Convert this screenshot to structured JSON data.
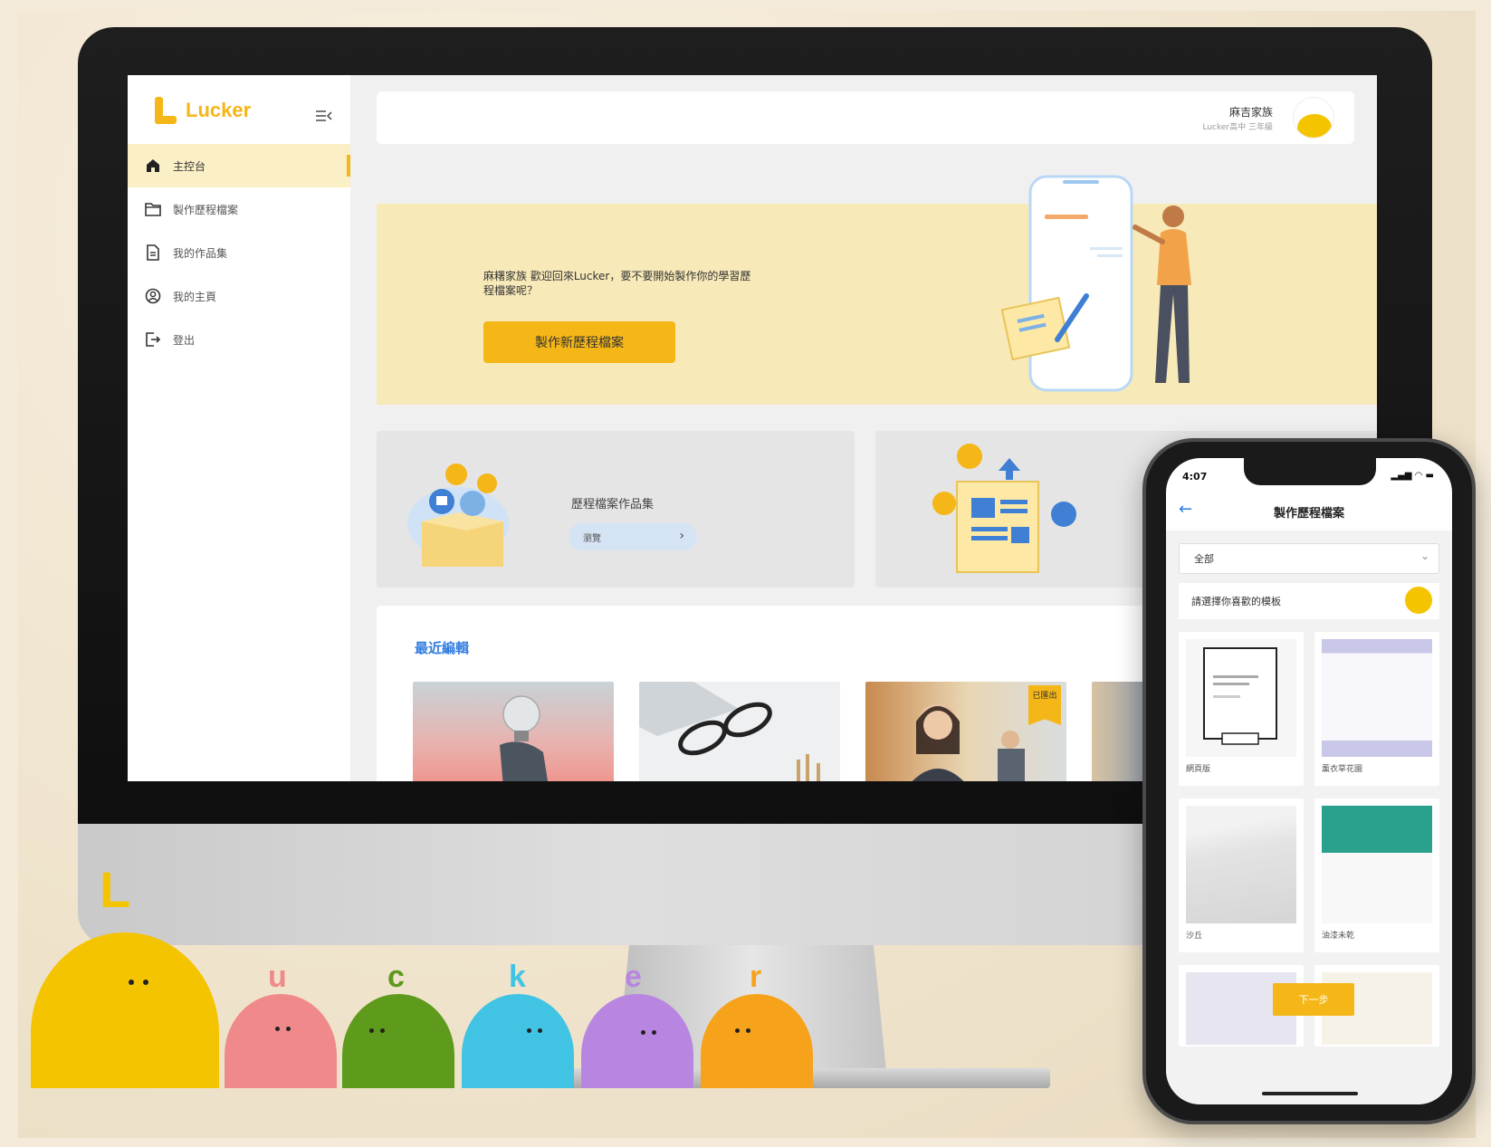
{
  "app": {
    "brand": "Lucker",
    "colors": {
      "accent": "#f5b617",
      "link": "#2f7be0",
      "hero_bg": "#f8e9b8"
    }
  },
  "sidebar": {
    "items": [
      {
        "label": "主控台",
        "icon": "home-icon",
        "active": true
      },
      {
        "label": "製作歷程檔案",
        "icon": "folder-icon",
        "active": false
      },
      {
        "label": "我的作品集",
        "icon": "document-icon",
        "active": false
      },
      {
        "label": "我的主頁",
        "icon": "user-circle-icon",
        "active": false
      },
      {
        "label": "登出",
        "icon": "logout-icon",
        "active": false
      }
    ]
  },
  "user": {
    "name": "麻吉家族",
    "meta": "Lucker高中 三年級"
  },
  "hero": {
    "message": "麻糬家族 歡迎回來Lucker，要不要開始製作你的學習歷程檔案呢？",
    "button": "製作新歷程檔案"
  },
  "cards": [
    {
      "title": "歷程檔案作品集",
      "button": "瀏覽"
    }
  ],
  "recent": {
    "title": "最近編輯",
    "items": [
      {
        "image": "lightbulb-photo"
      },
      {
        "image": "glasses-photo"
      },
      {
        "image": "student-photo",
        "badge": "已匯出"
      },
      {
        "image": "classroom-photo"
      }
    ]
  },
  "phone": {
    "time": "4:07",
    "title": "製作歷程檔案",
    "filter_value": "全部",
    "prompt": "請選擇你喜歡的模板",
    "templates": [
      {
        "label": "網頁版"
      },
      {
        "label": "薰衣草花園"
      },
      {
        "label": "沙丘"
      },
      {
        "label": "油漆未乾"
      }
    ],
    "next_button": "下一步"
  },
  "mascots": [
    "L",
    "u",
    "c",
    "k",
    "e",
    "r"
  ]
}
